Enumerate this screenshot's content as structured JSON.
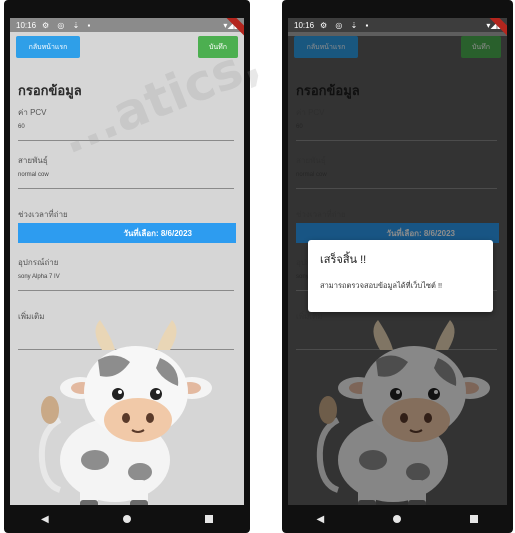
{
  "status": {
    "time": "10:16",
    "left_icons": "⚙ ◎ ⇣ ▪",
    "right_icons": "▾◢▮"
  },
  "topbar": {
    "home_label": "กลับหน้าแรก",
    "save_label": "บันทึก"
  },
  "form": {
    "title": "กรอกข้อมูล",
    "fields": [
      {
        "label": "ค่า PCV",
        "value": "60"
      },
      {
        "label": "สายพันธุ์",
        "value": "normal cow"
      },
      {
        "label": "ช่วงเวลาที่ถ่าย",
        "value": ""
      },
      {
        "label": "อุปกรณ์ถ่าย",
        "value": "sony Alpha 7 IV"
      },
      {
        "label": "เพิ่มเติม",
        "value": ""
      }
    ],
    "date_button": "วันที่เลือก: 8/6/2023"
  },
  "dialog": {
    "title": "เสร็จสิ้น !!",
    "message": "สามารถตรวจสอบข้อมูลได้ที่เว็บไซต์ !!"
  },
  "watermark": "...atics,",
  "colors": {
    "primary": "#2d9cf0",
    "save": "#4caf50",
    "screen_bg": "#d6d6d6",
    "dialog_bg": "#ffffff"
  }
}
